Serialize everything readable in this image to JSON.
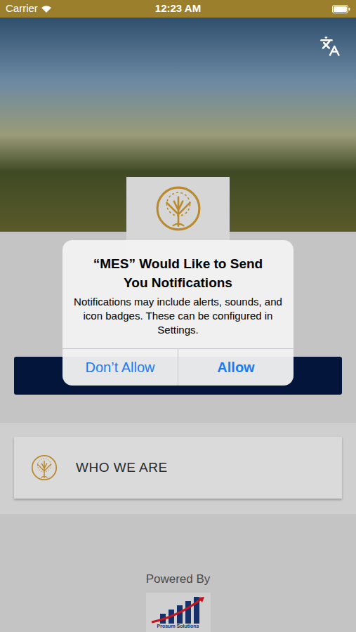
{
  "status_bar": {
    "carrier": "Carrier",
    "time": "12:23 AM"
  },
  "alert": {
    "title": "“MES” Would Like to Send You Notifications",
    "message": "Notifications may include alerts, sounds, and icon badges. These can be configured in Settings.",
    "buttons": [
      {
        "label": "Don’t Allow",
        "preferred": false
      },
      {
        "label": "Allow",
        "preferred": true
      }
    ]
  },
  "menu_items": [
    {
      "label": "WHO WE ARE"
    }
  ],
  "footer": {
    "powered_by": "Powered By",
    "logo_text": "Prosum Solutions"
  }
}
